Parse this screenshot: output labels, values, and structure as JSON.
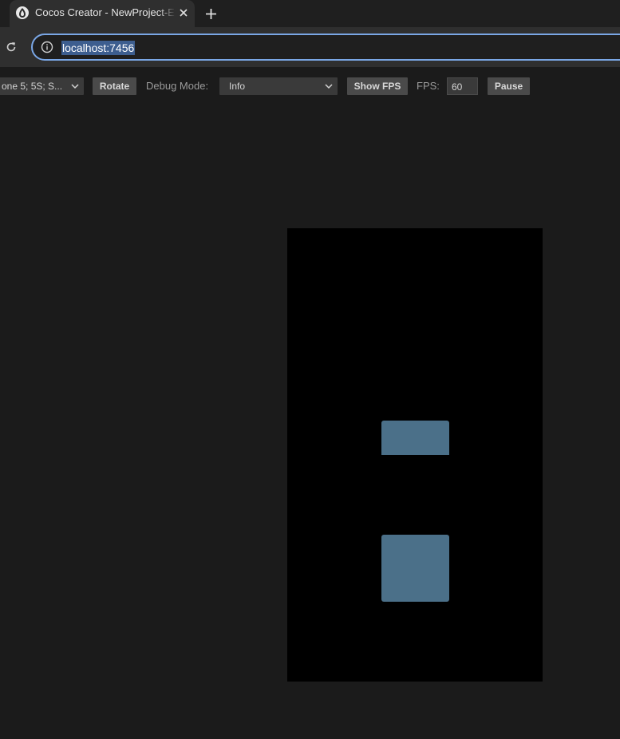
{
  "browser": {
    "tab_title": "Cocos Creator - NewProject-Example",
    "new_tab_symbol": "+",
    "url": "localhost:7456"
  },
  "toolbar": {
    "device_select": "one 5; 5S; S...",
    "rotate_label": "Rotate",
    "debug_mode_label": "Debug Mode:",
    "debug_mode_value": "Info",
    "show_fps_label": "Show FPS",
    "fps_label": "FPS:",
    "fps_value": "60",
    "pause_label": "Pause"
  },
  "scene": {
    "background_color": "#000000",
    "sprite_color": "#4b7089"
  },
  "colors": {
    "page_bg": "#1b1b1b",
    "address_focus": "#7aa7e6",
    "url_highlight": "#3d5e8f"
  }
}
